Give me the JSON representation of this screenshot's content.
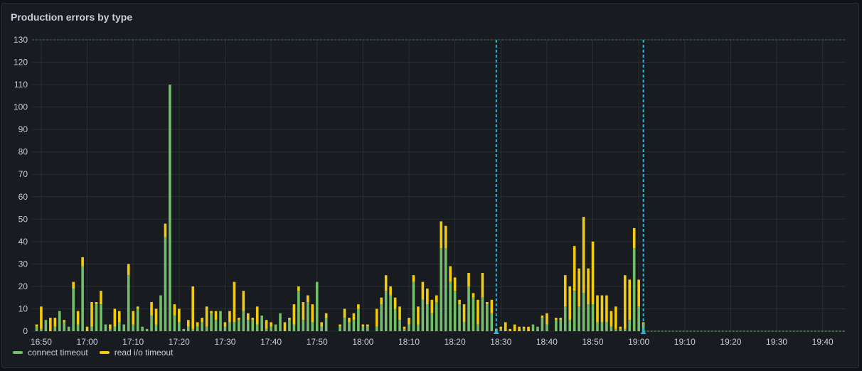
{
  "panel": {
    "title": "Production errors by type"
  },
  "colors": {
    "connect": "#73bf69",
    "read": "#f2cc0c",
    "annotation": "#1fb8e6",
    "grid": "#2b2e33",
    "axis_text": "#ccccdc"
  },
  "chart_data": {
    "type": "bar",
    "stacked": true,
    "x_unit": "time (1-minute buckets)",
    "x_range": [
      "16:48",
      "19:45"
    ],
    "ylim": [
      0,
      130
    ],
    "y_ticks": [
      0,
      10,
      20,
      30,
      40,
      50,
      60,
      70,
      80,
      90,
      100,
      110,
      120,
      130
    ],
    "x_tick_labels": [
      "16:50",
      "17:00",
      "17:10",
      "17:20",
      "17:30",
      "17:40",
      "17:50",
      "18:00",
      "18:10",
      "18:20",
      "18:30",
      "18:40",
      "18:50",
      "19:00",
      "19:10",
      "19:20",
      "19:30",
      "19:40"
    ],
    "grid": true,
    "legend": "bottom-left",
    "annotations": [
      "18:29",
      "19:01"
    ],
    "series": [
      {
        "name": "connect timeout",
        "color": "#73bf69",
        "points": [
          [
            "16:49",
            2
          ],
          [
            "16:50",
            1
          ],
          [
            "16:51",
            5
          ],
          [
            "16:53",
            2
          ],
          [
            "16:54",
            9
          ],
          [
            "16:55",
            4
          ],
          [
            "16:56",
            2
          ],
          [
            "16:57",
            19
          ],
          [
            "16:58",
            3
          ],
          [
            "16:59",
            29
          ],
          [
            "17:01",
            2
          ],
          [
            "17:02",
            12
          ],
          [
            "17:03",
            12
          ],
          [
            "17:04",
            3
          ],
          [
            "17:05",
            1
          ],
          [
            "17:06",
            2
          ],
          [
            "17:07",
            4
          ],
          [
            "17:08",
            3
          ],
          [
            "17:09",
            25
          ],
          [
            "17:10",
            3
          ],
          [
            "17:11",
            10
          ],
          [
            "17:12",
            2
          ],
          [
            "17:13",
            1
          ],
          [
            "17:14",
            7
          ],
          [
            "17:15",
            3
          ],
          [
            "17:16",
            16
          ],
          [
            "17:17",
            42
          ],
          [
            "17:18",
            110
          ],
          [
            "17:19",
            7
          ],
          [
            "17:20",
            4
          ],
          [
            "17:21",
            1
          ],
          [
            "17:22",
            2
          ],
          [
            "17:23",
            1
          ],
          [
            "17:24",
            2
          ],
          [
            "17:25",
            4
          ],
          [
            "17:26",
            2
          ],
          [
            "17:27",
            8
          ],
          [
            "17:28",
            5
          ],
          [
            "17:29",
            9
          ],
          [
            "17:30",
            2
          ],
          [
            "17:31",
            4
          ],
          [
            "17:32",
            4
          ],
          [
            "17:33",
            5
          ],
          [
            "17:34",
            9
          ],
          [
            "17:35",
            5
          ],
          [
            "17:36",
            5
          ],
          [
            "17:37",
            3
          ],
          [
            "17:38",
            7
          ],
          [
            "17:39",
            1
          ],
          [
            "17:40",
            2
          ],
          [
            "17:41",
            3
          ],
          [
            "17:42",
            8
          ],
          [
            "17:44",
            5
          ],
          [
            "17:45",
            3
          ],
          [
            "17:46",
            18
          ],
          [
            "17:47",
            5
          ],
          [
            "17:48",
            13
          ],
          [
            "17:49",
            4
          ],
          [
            "17:50",
            22
          ],
          [
            "17:51",
            2
          ],
          [
            "17:52",
            6
          ],
          [
            "17:55",
            2
          ],
          [
            "17:56",
            6
          ],
          [
            "17:57",
            4
          ],
          [
            "17:58",
            5
          ],
          [
            "17:59",
            10
          ],
          [
            "18:00",
            2
          ],
          [
            "18:01",
            2
          ],
          [
            "18:03",
            2
          ],
          [
            "18:04",
            12
          ],
          [
            "18:05",
            18
          ],
          [
            "18:06",
            16
          ],
          [
            "18:07",
            10
          ],
          [
            "18:08",
            5
          ],
          [
            "18:09",
            1
          ],
          [
            "18:10",
            3
          ],
          [
            "18:11",
            22
          ],
          [
            "18:12",
            3
          ],
          [
            "18:13",
            14
          ],
          [
            "18:14",
            12
          ],
          [
            "18:15",
            8
          ],
          [
            "18:16",
            13
          ],
          [
            "18:17",
            37
          ],
          [
            "18:18",
            37
          ],
          [
            "18:19",
            22
          ],
          [
            "18:20",
            18
          ],
          [
            "18:21",
            12
          ],
          [
            "18:22",
            4
          ],
          [
            "18:23",
            20
          ],
          [
            "18:24",
            15
          ],
          [
            "18:25",
            3
          ],
          [
            "18:26",
            15
          ],
          [
            "18:27",
            12
          ],
          [
            "18:28",
            8
          ],
          [
            "18:30",
            1
          ],
          [
            "18:31",
            0
          ],
          [
            "18:34",
            0
          ],
          [
            "18:35",
            1
          ],
          [
            "18:36",
            0
          ],
          [
            "18:37",
            3
          ],
          [
            "18:38",
            2
          ],
          [
            "18:39",
            6
          ],
          [
            "18:40",
            3
          ],
          [
            "18:42",
            5
          ],
          [
            "18:43",
            5
          ],
          [
            "18:44",
            11
          ],
          [
            "18:45",
            5
          ],
          [
            "18:46",
            18
          ],
          [
            "18:47",
            11
          ],
          [
            "18:48",
            17
          ],
          [
            "18:49",
            12
          ],
          [
            "18:50",
            12
          ],
          [
            "18:51",
            4
          ],
          [
            "18:52",
            4
          ],
          [
            "18:53",
            4
          ],
          [
            "18:54",
            2
          ],
          [
            "18:55",
            1
          ],
          [
            "18:56",
            1
          ],
          [
            "18:57",
            1
          ],
          [
            "18:58",
            5
          ],
          [
            "18:59",
            37
          ],
          [
            "19:00",
            11
          ],
          [
            "19:01",
            2
          ]
        ]
      },
      {
        "name": "read i/o timeout",
        "color": "#f2cc0c",
        "points": [
          [
            "16:49",
            1
          ],
          [
            "16:50",
            10
          ],
          [
            "16:52",
            6
          ],
          [
            "16:53",
            4
          ],
          [
            "16:55",
            1
          ],
          [
            "16:57",
            3
          ],
          [
            "16:58",
            6
          ],
          [
            "16:59",
            4
          ],
          [
            "17:00",
            2
          ],
          [
            "17:01",
            11
          ],
          [
            "17:02",
            1
          ],
          [
            "17:03",
            6
          ],
          [
            "17:05",
            2
          ],
          [
            "17:06",
            8
          ],
          [
            "17:07",
            5
          ],
          [
            "17:09",
            5
          ],
          [
            "17:10",
            6
          ],
          [
            "17:11",
            1
          ],
          [
            "17:14",
            6
          ],
          [
            "17:15",
            7
          ],
          [
            "17:17",
            6
          ],
          [
            "17:19",
            5
          ],
          [
            "17:20",
            6
          ],
          [
            "17:22",
            3
          ],
          [
            "17:23",
            19
          ],
          [
            "17:24",
            2
          ],
          [
            "17:25",
            2
          ],
          [
            "17:26",
            9
          ],
          [
            "17:27",
            1
          ],
          [
            "17:28",
            4
          ],
          [
            "17:30",
            2
          ],
          [
            "17:31",
            5
          ],
          [
            "17:32",
            18
          ],
          [
            "17:33",
            1
          ],
          [
            "17:34",
            9
          ],
          [
            "17:35",
            3
          ],
          [
            "17:36",
            1
          ],
          [
            "17:37",
            8
          ],
          [
            "17:39",
            4
          ],
          [
            "17:40",
            2
          ],
          [
            "17:43",
            4
          ],
          [
            "17:44",
            1
          ],
          [
            "17:45",
            9
          ],
          [
            "17:46",
            2
          ],
          [
            "17:47",
            8
          ],
          [
            "17:48",
            3
          ],
          [
            "17:49",
            8
          ],
          [
            "17:51",
            2
          ],
          [
            "17:52",
            2
          ],
          [
            "17:55",
            1
          ],
          [
            "17:56",
            4
          ],
          [
            "17:57",
            2
          ],
          [
            "17:58",
            3
          ],
          [
            "17:59",
            2
          ],
          [
            "18:00",
            1
          ],
          [
            "18:01",
            1
          ],
          [
            "18:03",
            8
          ],
          [
            "18:04",
            3
          ],
          [
            "18:05",
            7
          ],
          [
            "18:06",
            4
          ],
          [
            "18:07",
            5
          ],
          [
            "18:08",
            6
          ],
          [
            "18:09",
            1
          ],
          [
            "18:10",
            3
          ],
          [
            "18:11",
            3
          ],
          [
            "18:12",
            8
          ],
          [
            "18:13",
            8
          ],
          [
            "18:14",
            7
          ],
          [
            "18:15",
            6
          ],
          [
            "18:16",
            3
          ],
          [
            "18:17",
            12
          ],
          [
            "18:18",
            10
          ],
          [
            "18:19",
            7
          ],
          [
            "18:20",
            6
          ],
          [
            "18:21",
            2
          ],
          [
            "18:22",
            8
          ],
          [
            "18:23",
            6
          ],
          [
            "18:24",
            2
          ],
          [
            "18:25",
            11
          ],
          [
            "18:26",
            11
          ],
          [
            "18:27",
            1
          ],
          [
            "18:28",
            6
          ],
          [
            "18:29",
            1
          ],
          [
            "18:30",
            1
          ],
          [
            "18:31",
            4
          ],
          [
            "18:32",
            1
          ],
          [
            "18:33",
            3
          ],
          [
            "18:34",
            2
          ],
          [
            "18:35",
            1
          ],
          [
            "18:36",
            2
          ],
          [
            "18:39",
            1
          ],
          [
            "18:40",
            5
          ],
          [
            "18:42",
            1
          ],
          [
            "18:43",
            1
          ],
          [
            "18:44",
            14
          ],
          [
            "18:45",
            15
          ],
          [
            "18:46",
            20
          ],
          [
            "18:47",
            17
          ],
          [
            "18:48",
            34
          ],
          [
            "18:49",
            16
          ],
          [
            "18:50",
            28
          ],
          [
            "18:51",
            12
          ],
          [
            "18:52",
            12
          ],
          [
            "18:53",
            12
          ],
          [
            "18:54",
            7
          ],
          [
            "18:55",
            10
          ],
          [
            "18:56",
            1
          ],
          [
            "18:57",
            24
          ],
          [
            "18:58",
            18
          ],
          [
            "18:59",
            9
          ],
          [
            "19:00",
            12
          ],
          [
            "19:01",
            2
          ]
        ]
      }
    ]
  }
}
